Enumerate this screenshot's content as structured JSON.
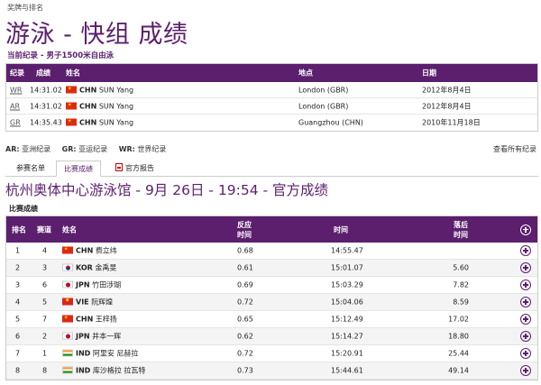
{
  "breadcrumb": "奖牌与排名",
  "page_title": "游泳 - 快组 成绩",
  "record_caption": "当前纪录 - 男子1500米自由泳",
  "records": {
    "headers": [
      "纪录",
      "成绩",
      "姓名",
      "地点",
      "日期"
    ],
    "rows": [
      {
        "code": "WR",
        "time": "14:31.02",
        "noc": "CHN",
        "flag": "chn",
        "name": "SUN Yang",
        "place": "London (GBR)",
        "date": "2012年8月4日"
      },
      {
        "code": "AR",
        "time": "14:31.02",
        "noc": "CHN",
        "flag": "chn",
        "name": "SUN Yang",
        "place": "London (GBR)",
        "date": "2012年8月4日"
      },
      {
        "code": "GR",
        "time": "14:35.43",
        "noc": "CHN",
        "flag": "chn",
        "name": "SUN Yang",
        "place": "Guangzhou (CHN)",
        "date": "2010年11月18日"
      }
    ]
  },
  "legend": {
    "ar_key": "AR:",
    "ar_label": "亚洲纪录",
    "gr_key": "GR:",
    "gr_label": "亚运纪录",
    "wr_key": "WR:",
    "wr_label": "世界纪录"
  },
  "view_all": "查看所有纪录",
  "tabs": {
    "entries": "参赛名单",
    "results": "比赛成绩",
    "report": "官方报告"
  },
  "venue_title": "杭州奥体中心游泳馆 - 9月 26日 - 19:54 - 官方成绩",
  "results_caption": "比赛成绩",
  "results": {
    "headers": {
      "rank": "排名",
      "lane": "赛道",
      "name": "姓名",
      "reaction_1": "反应",
      "reaction_2": "时间",
      "time": "时间",
      "behind_1": "落后",
      "behind_2": "时间"
    },
    "rows": [
      {
        "rank": "1",
        "lane": "4",
        "flag": "chn",
        "noc": "CHN",
        "name": "费立纬",
        "reaction": "0.68",
        "time": "14:55.47",
        "behind": ""
      },
      {
        "rank": "2",
        "lane": "3",
        "flag": "kor",
        "noc": "KOR",
        "name": "金禹旻",
        "reaction": "0.61",
        "time": "15:01.07",
        "behind": "5.60"
      },
      {
        "rank": "3",
        "lane": "6",
        "flag": "jpn",
        "noc": "JPN",
        "name": "竹田涉瑚",
        "reaction": "0.69",
        "time": "15:03.29",
        "behind": "7.82"
      },
      {
        "rank": "4",
        "lane": "5",
        "flag": "vie",
        "noc": "VIE",
        "name": "阮辉煌",
        "reaction": "0.72",
        "time": "15:04.06",
        "behind": "8.59"
      },
      {
        "rank": "5",
        "lane": "7",
        "flag": "chn",
        "noc": "CHN",
        "name": "王梓扬",
        "reaction": "0.65",
        "time": "15:12.49",
        "behind": "17.02"
      },
      {
        "rank": "6",
        "lane": "2",
        "flag": "jpn",
        "noc": "JPN",
        "name": "井本一辉",
        "reaction": "0.62",
        "time": "15:14.27",
        "behind": "18.80"
      },
      {
        "rank": "7",
        "lane": "1",
        "flag": "ind",
        "noc": "IND",
        "name": "阿里安 尼赫拉",
        "reaction": "0.72",
        "time": "15:20.91",
        "behind": "25.44"
      },
      {
        "rank": "8",
        "lane": "8",
        "flag": "ind",
        "noc": "IND",
        "name": "库沙格拉 拉瓦特",
        "reaction": "0.73",
        "time": "15:44.61",
        "behind": "49.14"
      }
    ]
  },
  "colors": {
    "brand_purple": "#5b1f6e"
  }
}
